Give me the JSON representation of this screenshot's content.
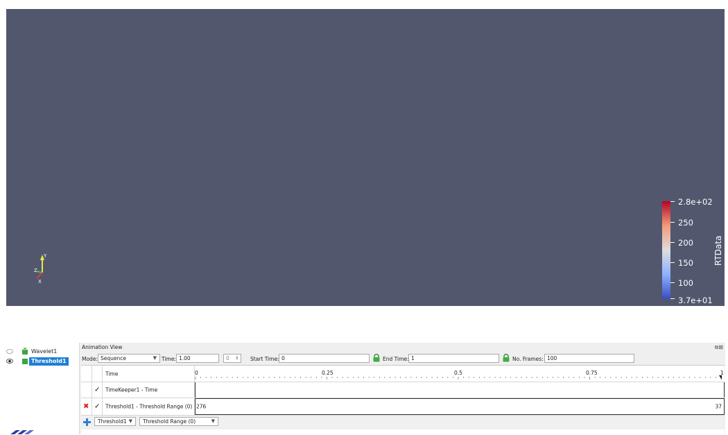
{
  "render": {
    "background": "#52576e",
    "axes": {
      "x": "X",
      "y": "Y",
      "z": "Z"
    },
    "colorbar": {
      "title": "RTData",
      "labels": [
        "2.8e+02",
        "250",
        "200",
        "150",
        "100",
        "3.7e+01"
      ],
      "range": [
        37,
        280
      ],
      "colors": [
        "#3b4cc0",
        "#8db0fe",
        "#dddddd",
        "#f49a7b",
        "#b40426"
      ]
    }
  },
  "pipeline": {
    "items": [
      {
        "label": "Wavelet1",
        "visible": false
      },
      {
        "label": "Threshold1",
        "visible": true,
        "selected": true
      }
    ]
  },
  "animation": {
    "title": "Animation View",
    "mode_label": "Mode:",
    "mode_value": "Sequence",
    "time_label": "Time:",
    "time_value": "1.00",
    "time_index": "0",
    "start_label": "Start Time:",
    "start_value": "0",
    "end_label": "End Time:",
    "end_value": "1",
    "frames_label": "No. Frames:",
    "frames_value": "100",
    "table": {
      "header": "Time",
      "ticks": [
        "0",
        "0.25",
        "0.5",
        "0.75",
        "1"
      ],
      "tracks": [
        {
          "name": "TimeKeeper1 - Time",
          "checked": true,
          "start": "",
          "end": ""
        },
        {
          "name": "Threshold1 - Threshold Range (0)",
          "checked": true,
          "start": "276",
          "end": "37"
        }
      ],
      "add_source": "Threshold1",
      "add_property": "Threshold Range (0)"
    }
  }
}
